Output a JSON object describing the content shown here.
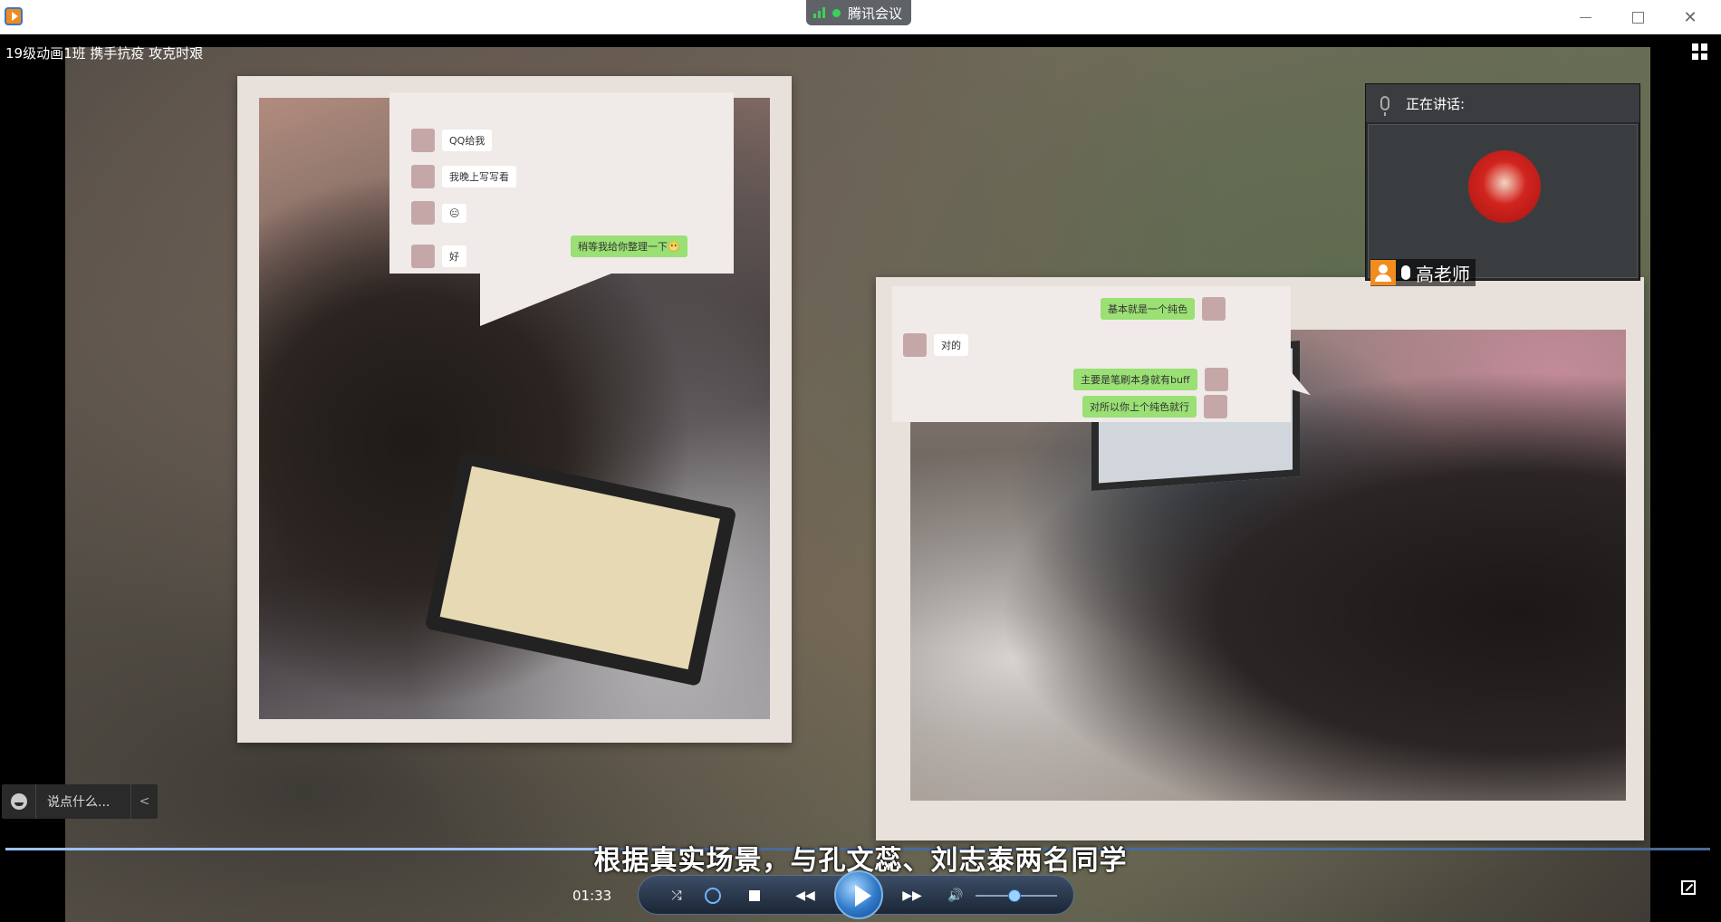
{
  "window": {
    "app_icon": "tencent-video-icon",
    "meeting_badge": "腾讯会议"
  },
  "video": {
    "title": "19级动画1班 携手抗疫    攻克时艰",
    "subtitle": "根据真实场景，与孔文蕊、刘志泰两名同学",
    "timecode": "01:33",
    "progress_fraction": 0.35,
    "volume_fraction": 0.48
  },
  "chat_left": {
    "messages": [
      {
        "side": "left",
        "text": "QQ给我"
      },
      {
        "side": "left",
        "text": "我晚上写写看"
      },
      {
        "side": "left",
        "text": "😐"
      },
      {
        "side": "right",
        "text": "稍等我给你整理一下😬"
      },
      {
        "side": "left",
        "text": "好"
      }
    ]
  },
  "chat_right": {
    "messages": [
      {
        "side": "right",
        "text": "基本就是一个纯色"
      },
      {
        "side": "left",
        "text": "对的"
      },
      {
        "side": "right",
        "text": "主要是笔刷本身就有buff"
      },
      {
        "side": "right",
        "text": "对所以你上个纯色就行"
      }
    ]
  },
  "speaker": {
    "heading": "正在讲话:",
    "name": "高老师"
  },
  "comment": {
    "placeholder": "说点什么..."
  },
  "colors": {
    "accent": "#2f79c9",
    "bubble_green": "#95e36b",
    "badge_orange": "#f28c1e"
  }
}
